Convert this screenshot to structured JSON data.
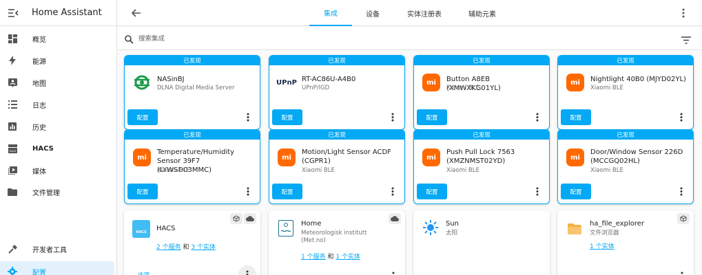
{
  "sidebar": {
    "title": "Home Assistant",
    "items": [
      {
        "label": "概览",
        "icon": "dashboard-icon"
      },
      {
        "label": "能源",
        "icon": "lightning-icon"
      },
      {
        "label": "地图",
        "icon": "map-icon"
      },
      {
        "label": "日志",
        "icon": "list-icon"
      },
      {
        "label": "历史",
        "icon": "chart-icon"
      },
      {
        "label": "HACS",
        "icon": "hacs-icon"
      },
      {
        "label": "媒体",
        "icon": "media-icon"
      },
      {
        "label": "文件管理",
        "icon": "folder-icon"
      },
      {
        "label": "开发者工具",
        "icon": "hammer-icon"
      },
      {
        "label": "配置",
        "icon": "gear-icon"
      }
    ]
  },
  "tabs": [
    "集成",
    "设备",
    "实体注册表",
    "辅助元素"
  ],
  "search": {
    "placeholder": "搜索集成"
  },
  "discovered_label": "已发现",
  "configure_label": "配置",
  "discovered": [
    {
      "name": "NASinBJ",
      "sub": "DLNA Digital Media Server",
      "logo": "dlna-icon"
    },
    {
      "name": "RT-AC86U-A4B0",
      "sub": "UPnP/IGD",
      "logo": "upnp-icon"
    },
    {
      "name": "Button A8EB (XMWXKG01YL)",
      "sub": "Xiaomi BLE",
      "logo": "xiaomi-icon"
    },
    {
      "name": "Nightlight 40B0 (MJYD02YL)",
      "sub": "Xiaomi BLE",
      "logo": "xiaomi-icon"
    },
    {
      "name": "Temperature/Humidity Sensor 39F7 (LYWSD03MMC)",
      "sub": "Xiaomi BLE",
      "logo": "xiaomi-icon"
    },
    {
      "name": "Motion/Light Sensor ACDF (CGPR1)",
      "sub": "Xiaomi BLE",
      "logo": "xiaomi-icon"
    },
    {
      "name": "Push Pull Lock 7563 (XMZNMST02YD)",
      "sub": "Xiaomi BLE",
      "logo": "xiaomi-icon"
    },
    {
      "name": "Door/Window Sensor 226D (MCCGQ02HL)",
      "sub": "Xiaomi BLE",
      "logo": "xiaomi-icon"
    }
  ],
  "upnp_logo_text": "UPnP",
  "mi_logo_text": "mi",
  "hacs_logo_text": "HACS",
  "configured": [
    {
      "name": "HACS",
      "sub": "",
      "services": "2 个服务",
      "and": "和",
      "entities": "3 个实体",
      "logo": "hacs-icon"
    },
    {
      "name": "Home",
      "sub": "Meteorologisk institutt (Met.no)",
      "services": "1 个服务",
      "and": "和",
      "entities": "1 个实体",
      "logo": "met-icon"
    },
    {
      "name": "Sun",
      "sub": "太阳",
      "services": "",
      "and": "",
      "entities": "",
      "logo": "sun-icon"
    },
    {
      "name": "ha_file_explorer",
      "sub": "文件浏览器",
      "services": "",
      "and": "",
      "entities": "1 个实体",
      "logo": "folder-icon"
    }
  ],
  "bottom_partial_link": "选项",
  "colors": {
    "accent": "#03a9f4",
    "xiaomi": "#ff6900",
    "dlna": "#1a9b48"
  }
}
